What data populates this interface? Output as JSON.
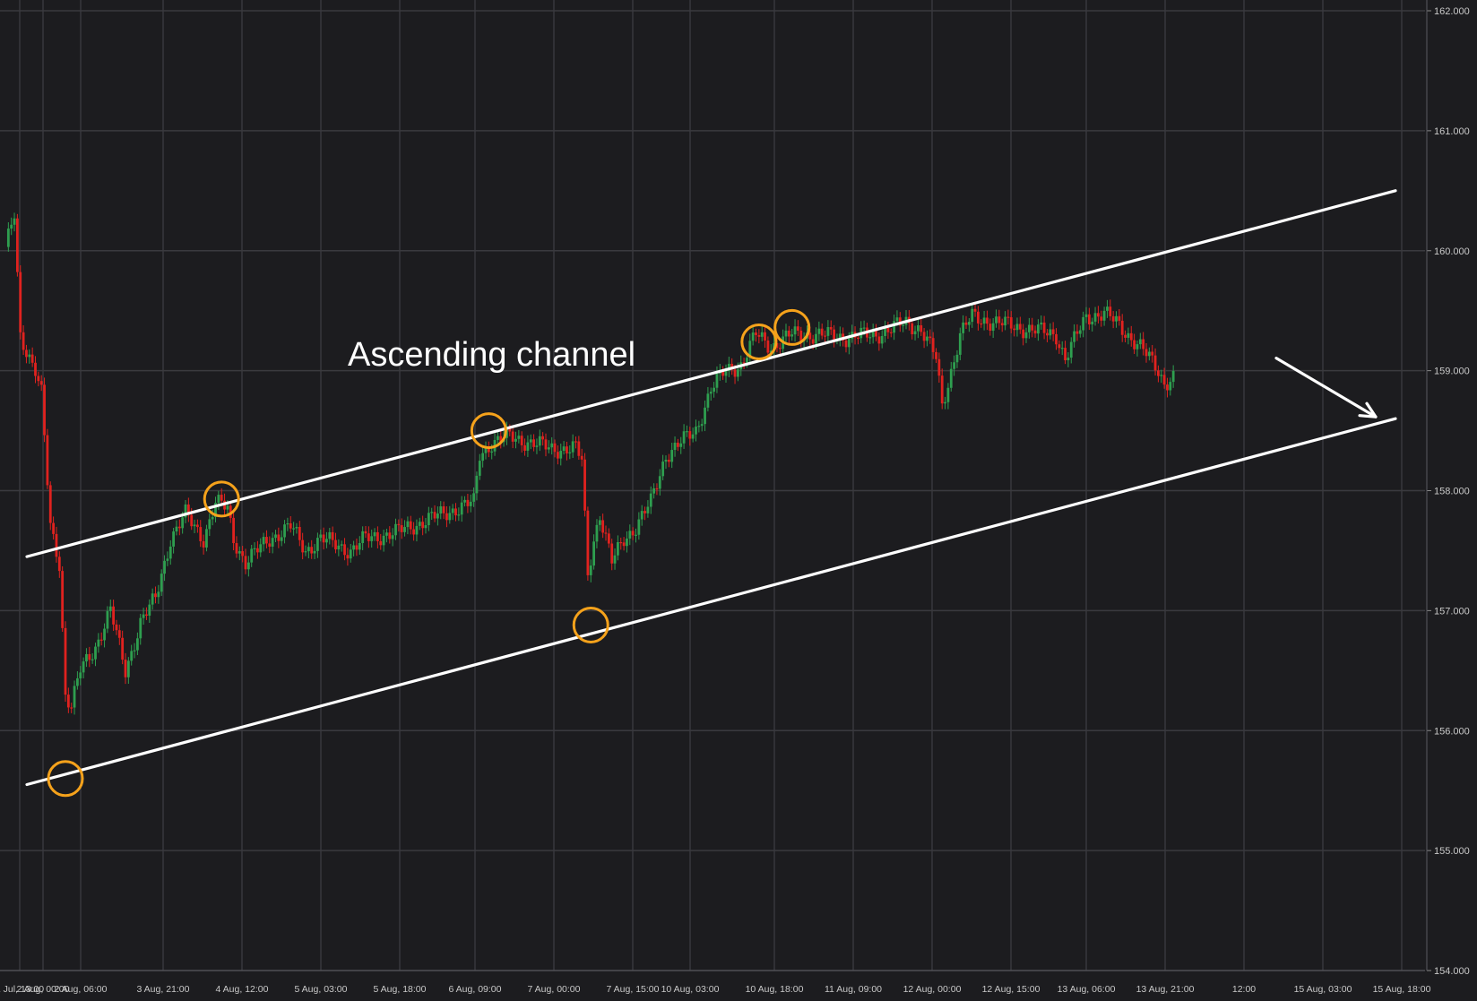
{
  "chart_data": {
    "type": "candlestick",
    "title": "",
    "xlabel": "",
    "ylabel": "",
    "ylim": [
      154.0,
      162.0
    ],
    "y_ticks": [
      "154.000",
      "155.000",
      "156.000",
      "157.000",
      "158.000",
      "159.000",
      "160.000",
      "161.000",
      "162.000"
    ],
    "x_ticks": [
      "1 Jul, 13:00",
      "2 Aug, 00:00",
      "2 Aug, 06:00",
      "3 Aug, 21:00",
      "4 Aug, 12:00",
      "5 Aug, 03:00",
      "5 Aug, 18:00",
      "6 Aug, 09:00",
      "7 Aug, 00:00",
      "7 Aug, 15:00",
      "10 Aug, 03:00",
      "10 Aug, 18:00",
      "11 Aug, 09:00",
      "12 Aug, 00:00",
      "12 Aug, 15:00",
      "13 Aug, 06:00",
      "13 Aug, 21:00",
      "12:00",
      "15 Aug, 03:00",
      "15 Aug, 18:00"
    ],
    "grid": true,
    "colors": {
      "up": "#2e9e4f",
      "down": "#e0221f",
      "background": "#1c1c1f",
      "grid": "#3a3a3f",
      "channel": "#ffffff",
      "marker": "#f5a21b"
    },
    "annotation": {
      "text": "Ascending channel"
    },
    "channel": {
      "upper": {
        "from": [
          0,
          157.45
        ],
        "to": [
          430,
          160.5
        ]
      },
      "lower": {
        "from": [
          0,
          155.55
        ],
        "to": [
          430,
          158.6
        ]
      }
    },
    "touch_points": [
      {
        "i": 20,
        "price": 155.6
      },
      {
        "i": 72,
        "price": 157.93
      },
      {
        "i": 161,
        "price": 158.5
      },
      {
        "i": 195,
        "price": 156.88
      },
      {
        "i": 251,
        "price": 159.24
      },
      {
        "i": 262,
        "price": 159.36
      }
    ],
    "projection_arrow": {
      "from": [
        375,
        159.0
      ],
      "to": [
        405,
        158.6
      ]
    },
    "keyframes": [
      [
        0,
        160.0
      ],
      [
        3,
        160.3
      ],
      [
        5,
        159.3
      ],
      [
        10,
        159.0
      ],
      [
        12,
        158.8
      ],
      [
        15,
        157.7
      ],
      [
        18,
        157.4
      ],
      [
        20,
        156.3
      ],
      [
        22,
        156.2
      ],
      [
        25,
        156.5
      ],
      [
        30,
        156.7
      ],
      [
        35,
        157.0
      ],
      [
        40,
        156.5
      ],
      [
        45,
        156.9
      ],
      [
        50,
        157.1
      ],
      [
        55,
        157.6
      ],
      [
        60,
        157.8
      ],
      [
        66,
        157.6
      ],
      [
        70,
        157.9
      ],
      [
        74,
        157.85
      ],
      [
        76,
        157.6
      ],
      [
        80,
        157.4
      ],
      [
        88,
        157.6
      ],
      [
        95,
        157.7
      ],
      [
        100,
        157.5
      ],
      [
        105,
        157.6
      ],
      [
        110,
        157.55
      ],
      [
        115,
        157.5
      ],
      [
        120,
        157.6
      ],
      [
        130,
        157.65
      ],
      [
        140,
        157.75
      ],
      [
        150,
        157.85
      ],
      [
        156,
        157.9
      ],
      [
        158,
        158.3
      ],
      [
        162,
        158.4
      ],
      [
        168,
        158.45
      ],
      [
        175,
        158.4
      ],
      [
        182,
        158.35
      ],
      [
        190,
        158.35
      ],
      [
        192,
        158.25
      ],
      [
        194,
        157.3
      ],
      [
        196,
        157.6
      ],
      [
        198,
        157.8
      ],
      [
        202,
        157.4
      ],
      [
        206,
        157.6
      ],
      [
        210,
        157.7
      ],
      [
        215,
        157.9
      ],
      [
        220,
        158.3
      ],
      [
        230,
        158.5
      ],
      [
        235,
        158.85
      ],
      [
        240,
        159.0
      ],
      [
        245,
        159.05
      ],
      [
        250,
        159.3
      ],
      [
        255,
        159.2
      ],
      [
        262,
        159.3
      ],
      [
        270,
        159.3
      ],
      [
        280,
        159.28
      ],
      [
        290,
        159.3
      ],
      [
        300,
        159.4
      ],
      [
        305,
        159.35
      ],
      [
        310,
        159.1
      ],
      [
        312,
        158.7
      ],
      [
        315,
        159.0
      ],
      [
        318,
        159.3
      ],
      [
        322,
        159.45
      ],
      [
        330,
        159.4
      ],
      [
        340,
        159.35
      ],
      [
        350,
        159.3
      ],
      [
        353,
        159.1
      ],
      [
        356,
        159.25
      ],
      [
        360,
        159.45
      ],
      [
        366,
        159.48
      ],
      [
        370,
        159.4
      ],
      [
        378,
        159.2
      ],
      [
        384,
        159.0
      ],
      [
        386,
        158.9
      ],
      [
        389,
        158.95
      ]
    ]
  }
}
